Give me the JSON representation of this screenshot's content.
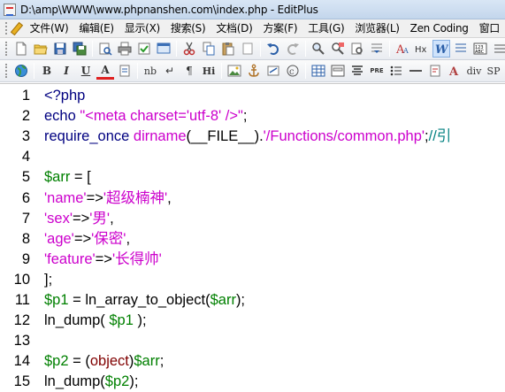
{
  "window": {
    "title": "D:\\amp\\WWW\\www.phpnanshen.com\\index.php - EditPlus"
  },
  "menu": {
    "items": [
      "文件(W)",
      "编辑(E)",
      "显示(X)",
      "搜索(S)",
      "文档(D)",
      "方案(F)",
      "工具(G)",
      "浏览器(L)",
      "Zen Coding",
      "窗口"
    ]
  },
  "toolbar2": {
    "text_buttons": {
      "bold": "B",
      "italic": "I",
      "underline": "U",
      "font_color": "A",
      "nbsp": "nb",
      "line_break": "↵",
      "paragraph": "¶",
      "heading": "Hi",
      "pre": "PRE",
      "div": "div",
      "span": "SP"
    }
  },
  "colors": {
    "keyword": "#000080",
    "string": "#cc00cc",
    "variable": "#008000",
    "function": "#cc00cc",
    "comment": "#008080"
  },
  "editor": {
    "lines": [
      {
        "num": "1",
        "tokens": [
          {
            "t": "<?php",
            "c": "keyword"
          }
        ]
      },
      {
        "num": "2",
        "tokens": [
          {
            "t": "echo ",
            "c": "keyword"
          },
          {
            "t": "\"<meta charset='utf-8' />\"",
            "c": "string"
          },
          {
            "t": ";",
            "c": "default"
          }
        ]
      },
      {
        "num": "3",
        "tokens": [
          {
            "t": "require_once ",
            "c": "keyword"
          },
          {
            "t": "dirname",
            "c": "func"
          },
          {
            "t": "(__FILE__).",
            "c": "default"
          },
          {
            "t": "'/Functions/common.php'",
            "c": "string"
          },
          {
            "t": ";",
            "c": "default"
          },
          {
            "t": "//引",
            "c": "comment"
          }
        ]
      },
      {
        "num": "4",
        "tokens": []
      },
      {
        "num": "5",
        "tokens": [
          {
            "t": "$arr",
            "c": "var"
          },
          {
            "t": " = [",
            "c": "default"
          }
        ]
      },
      {
        "num": "6",
        "tokens": [
          {
            "t": "'name'",
            "c": "string"
          },
          {
            "t": "=>",
            "c": "default"
          },
          {
            "t": "'超级楠神'",
            "c": "string"
          },
          {
            "t": ",",
            "c": "default"
          }
        ]
      },
      {
        "num": "7",
        "tokens": [
          {
            "t": "'sex'",
            "c": "string"
          },
          {
            "t": "=>",
            "c": "default"
          },
          {
            "t": "'男'",
            "c": "string"
          },
          {
            "t": ",",
            "c": "default"
          }
        ]
      },
      {
        "num": "8",
        "tokens": [
          {
            "t": "'age'",
            "c": "string"
          },
          {
            "t": "=>",
            "c": "default"
          },
          {
            "t": "'保密'",
            "c": "string"
          },
          {
            "t": ",",
            "c": "default"
          }
        ]
      },
      {
        "num": "9",
        "tokens": [
          {
            "t": "'feature'",
            "c": "string"
          },
          {
            "t": "=>",
            "c": "default"
          },
          {
            "t": "'长得帅'",
            "c": "string"
          }
        ]
      },
      {
        "num": "10",
        "tokens": [
          {
            "t": "];",
            "c": "default"
          }
        ]
      },
      {
        "num": "11",
        "tokens": [
          {
            "t": "$p1",
            "c": "var"
          },
          {
            "t": " = ln_array_to_object(",
            "c": "default"
          },
          {
            "t": "$arr",
            "c": "var"
          },
          {
            "t": ");",
            "c": "default"
          }
        ]
      },
      {
        "num": "12",
        "tokens": [
          {
            "t": "ln_dump( ",
            "c": "default"
          },
          {
            "t": "$p1",
            "c": "var"
          },
          {
            "t": " );",
            "c": "default"
          }
        ]
      },
      {
        "num": "13",
        "tokens": []
      },
      {
        "num": "14",
        "tokens": [
          {
            "t": "$p2",
            "c": "var"
          },
          {
            "t": " = (",
            "c": "default"
          },
          {
            "t": "object",
            "c": "brown"
          },
          {
            "t": ")",
            "c": "default"
          },
          {
            "t": "$arr",
            "c": "var"
          },
          {
            "t": ";",
            "c": "default"
          }
        ]
      },
      {
        "num": "15",
        "tokens": [
          {
            "t": "ln_dump(",
            "c": "default"
          },
          {
            "t": "$p2",
            "c": "var"
          },
          {
            "t": ");",
            "c": "default"
          }
        ]
      }
    ]
  }
}
